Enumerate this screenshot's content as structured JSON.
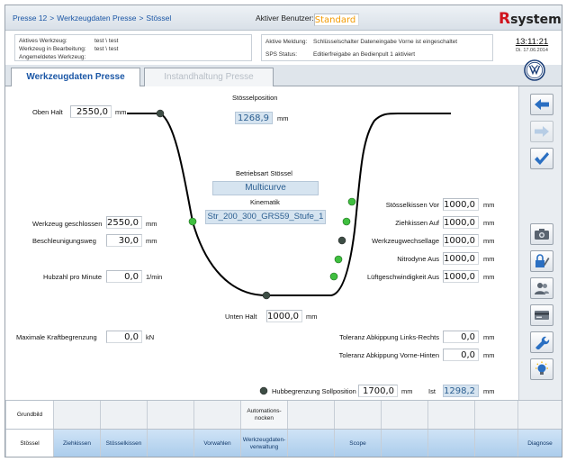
{
  "header": {
    "breadcrumb": [
      "Presse 12",
      "Werkzeugdaten Presse",
      "Stössel"
    ],
    "breadcrumb_sep": ">",
    "active_user_label": "Aktiver Benutzer:",
    "active_user_value": "Standard",
    "logo_r": "R",
    "logo_text": "systems"
  },
  "info_left": {
    "line1_label": "Aktives Werkzeug:",
    "line1_value": "test \\ test",
    "line2_label": "Werkzeug in Bearbeitung:",
    "line2_value": "test \\ test",
    "line3_label": "Angemeldetes Werkzeug:",
    "line3_value": ""
  },
  "info_mid": {
    "line1_label": "Aktive Meldung:",
    "line1_value": "Schlüsselschalter Dateneingabe Vorne ist eingeschaltet",
    "line2_label": "SPS Status:",
    "line2_value": "Editierfreigabe an Bedienpult 1 aktiviert"
  },
  "clock": {
    "time": "13:11:21",
    "date": "Di. 17.06.2014"
  },
  "tabs": [
    {
      "label": "Werkzeugdaten Presse",
      "active": true
    },
    {
      "label": "Instandhaltung Presse",
      "active": false
    }
  ],
  "main": {
    "oben_halt": {
      "label": "Oben Halt",
      "value": "2550,0",
      "unit": "mm"
    },
    "stoesselposition": {
      "label": "Stösselposition",
      "value": "1268,9",
      "unit": "mm"
    },
    "betriebsart": {
      "label": "Betriebsart Stössel",
      "value": "Multicurve"
    },
    "kinematik": {
      "label": "Kinematik",
      "value": "Str_200_300_GRS59_Stufe_1"
    },
    "werkzeug_geschlossen": {
      "label": "Werkzeug geschlossen",
      "value": "2550,0",
      "unit": "mm"
    },
    "beschleunigungsweg": {
      "label": "Beschleunigungsweg",
      "value": "30,0",
      "unit": "mm"
    },
    "hubzahl": {
      "label": "Hubzahl pro Minute",
      "value": "0,0",
      "unit": "1/min"
    },
    "unten_halt": {
      "label": "Unten Halt",
      "value": "1000,0",
      "unit": "mm"
    },
    "kraftbegrenzung": {
      "label": "Maximale Kraftbegrenzung",
      "value": "0,0",
      "unit": "kN"
    },
    "stoesselkissen_vor": {
      "label": "Stösselkissen Vor",
      "value": "1000,0",
      "unit": "mm"
    },
    "ziehkissen_auf": {
      "label": "Ziehkissen Auf",
      "value": "1000,0",
      "unit": "mm"
    },
    "werkzeugwechsellage": {
      "label": "Werkzeugwechsellage",
      "value": "1000,0",
      "unit": "mm"
    },
    "nitrodyne_aus": {
      "label": "Nitrodyne Aus",
      "value": "1000,0",
      "unit": "mm"
    },
    "lueftgeschwindigkeit_aus": {
      "label": "Lüftgeschwindigkeit Aus",
      "value": "1000,0",
      "unit": "mm"
    },
    "toleranz_lr": {
      "label": "Toleranz Abkippung Links-Rechts",
      "value": "0,0",
      "unit": "mm"
    },
    "toleranz_vh": {
      "label": "Toleranz Abkippung Vorne-Hinten",
      "value": "0,0",
      "unit": "mm"
    },
    "hubbegrenzung": {
      "label": "Hubbegrenzung Sollposition",
      "value": "1700,0",
      "unit": "mm",
      "ist_label": "Ist",
      "ist_value": "1298,2",
      "ist_unit": "mm"
    }
  },
  "toolbar_icons": [
    "arrow-left-icon",
    "arrow-right-icon",
    "checkmark-icon",
    "camera-icon",
    "lock-edit-icon",
    "users-icon",
    "card-icon",
    "wrench-icon",
    "lightbulb-icon"
  ],
  "bottom_row1": {
    "grundbild": "Grundbild",
    "automationsnocken": "Automations-\nnocken"
  },
  "bottom_row2": {
    "stoessel": "Stössel",
    "ziehkissen": "Ziehkissen",
    "stoesselkissen": "Stösselkissen",
    "vorwahlen": "Vorwahlen",
    "werkzeugdatenverwaltung": "Werkzeugdaten-\nverwaltung",
    "scope": "Scope",
    "diagnose": "Diagnose"
  },
  "colors": {
    "accent": "#1b57a6",
    "user": "#f39a00",
    "field_blue": "#d6e4f0",
    "button_blue": "#a9cbeb",
    "point_green": "#3fbf3f",
    "point_dark": "#3d4d45"
  }
}
